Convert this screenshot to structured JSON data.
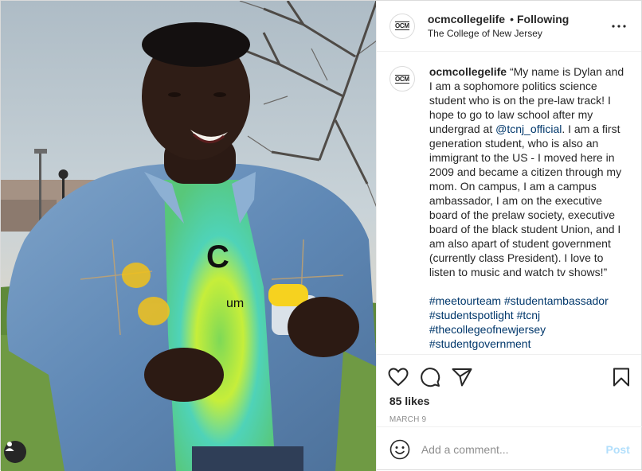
{
  "post": {
    "username": "ocmcollegelife",
    "separator": "•",
    "follow_status": "Following",
    "location": "The College of New Jersey",
    "avatar_text": "OCM",
    "more_icon": "more-options-icon"
  },
  "caption": {
    "username": "ocmcollegelife",
    "text_before": " “My name is Dylan and I am a sophomore politics science student who is on the pre-law track! I hope to go to law school after my undergrad at ",
    "mention": "@tcnj_official",
    "text_after": ". I am a first generation student, who is also an immigrant to the US - I moved here in 2009 and became a citizen through my mom. On campus, I am a campus ambassador, I am on the executive board of the prelaw society, executive board of the black student Union, and I am also apart of student government (currently class President). I love to listen to music and watch tv shows!”",
    "hashtags": [
      "#meetourteam",
      "#studentambassador",
      "#studentspotlight",
      "#tcnj",
      "#thecollegeofnewjersey",
      "#studentgovernment"
    ]
  },
  "actions": {
    "like_icon": "heart-icon",
    "comment_icon": "comment-icon",
    "share_icon": "paper-plane-icon",
    "save_icon": "bookmark-icon"
  },
  "likes": "85 likes",
  "date": "MARCH 9",
  "comment_box": {
    "placeholder": "Add a comment...",
    "post_label": "Post",
    "emoji_icon": "emoji-icon"
  },
  "photo": {
    "tag_icon": "user-tag-icon"
  },
  "colors": {
    "link": "#00376b",
    "border": "#dbdbdb",
    "muted": "#8e8e8e",
    "post_disabled": "#b2dffc"
  }
}
